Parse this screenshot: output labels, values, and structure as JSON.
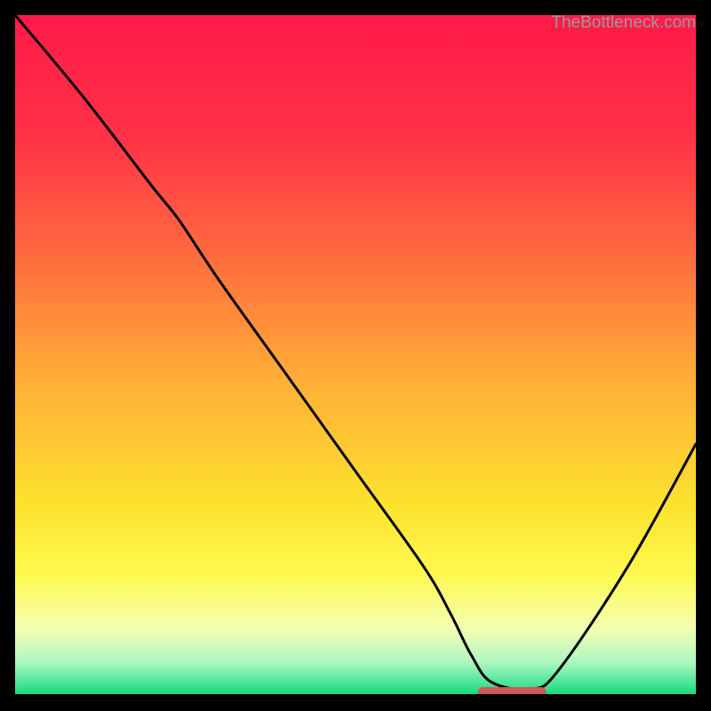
{
  "watermark": "TheBottleneck.com",
  "chart_data": {
    "type": "line",
    "title": "",
    "xlabel": "",
    "ylabel": "",
    "xlim": [
      0,
      100
    ],
    "ylim": [
      0,
      100
    ],
    "series": [
      {
        "name": "bottleneck-curve",
        "x": [
          0,
          10,
          20,
          24,
          30,
          40,
          50,
          60,
          64,
          67,
          70,
          76,
          80,
          90,
          100
        ],
        "y": [
          100,
          88,
          75,
          70,
          61,
          47,
          33,
          19,
          12,
          6,
          2,
          1,
          4,
          19,
          37
        ]
      }
    ],
    "sweet_spot_marker": {
      "x_start": 68,
      "x_end": 78,
      "y": 0.5,
      "color": "#cc5a5a"
    },
    "gradient_stops": [
      {
        "offset": 0,
        "color": "#ff1a48"
      },
      {
        "offset": 18,
        "color": "#ff3247"
      },
      {
        "offset": 35,
        "color": "#ff6a3f"
      },
      {
        "offset": 55,
        "color": "#ffb236"
      },
      {
        "offset": 72,
        "color": "#fce22e"
      },
      {
        "offset": 82,
        "color": "#fff94e"
      },
      {
        "offset": 90,
        "color": "#f3ffb0"
      },
      {
        "offset": 95,
        "color": "#b0f7c2"
      },
      {
        "offset": 98,
        "color": "#4de69a"
      },
      {
        "offset": 100,
        "color": "#14d776"
      }
    ]
  }
}
